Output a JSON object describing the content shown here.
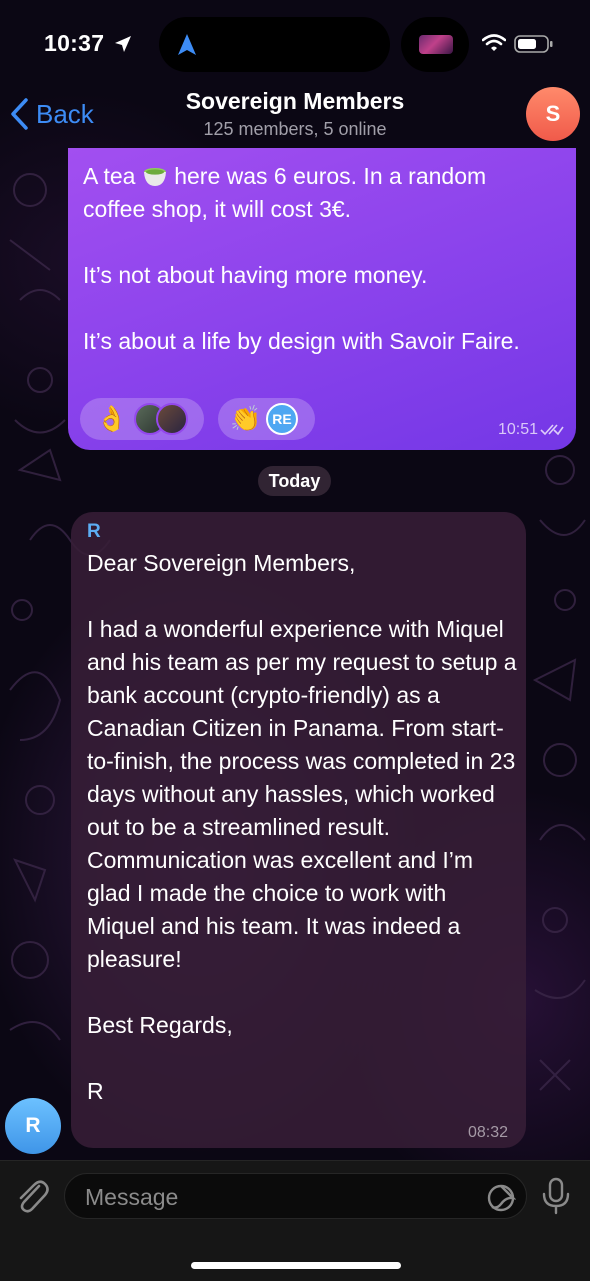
{
  "status_bar": {
    "time": "10:37"
  },
  "header": {
    "back_label": "Back",
    "title": "Sovereign Members",
    "subtitle": "125 members, 5 online",
    "avatar_letter": "S"
  },
  "outgoing_message": {
    "line1_before_emoji": "A tea ",
    "line1_after_emoji": " here was 6 euros. In a random",
    "line2": "coffee shop, it will cost 3€.",
    "paragraph2": "It’s not about having more money.",
    "paragraph3": "It’s about a life by design with Savoir Faire.",
    "reactions": [
      {
        "emoji": "👌"
      },
      {
        "emoji": "👏",
        "user_badge": "RE"
      }
    ],
    "time": "10:51"
  },
  "date_divider": "Today",
  "incoming_message": {
    "sender": "R",
    "text": "Dear Sovereign Members,\n\nI had a wonderful experience with Miquel and his team as per my request to setup a bank account (crypto-friendly) as a Canadian Citizen in Panama. From start-to-finish, the process was completed in 23 days without any hassles, which worked out to be a streamlined result. Communication was excellent and I’m glad I made the choice to work with Miquel and his team. It was indeed a pleasure!\n\nBest Regards,\n\nR",
    "time": "08:32",
    "avatar_letter": "R"
  },
  "composer": {
    "placeholder": "Message"
  },
  "colors": {
    "accent": "#3d8cf5",
    "outgoing_bubble": "#8b43ec",
    "incoming_bubble": "#371e37",
    "sender_name": "#5cadf3"
  },
  "icons": [
    "back-chevron-icon",
    "location-arrow-icon",
    "navigation-icon",
    "wifi-icon",
    "battery-icon",
    "double-check-icon",
    "paperclip-icon",
    "sticker-icon",
    "microphone-icon"
  ]
}
